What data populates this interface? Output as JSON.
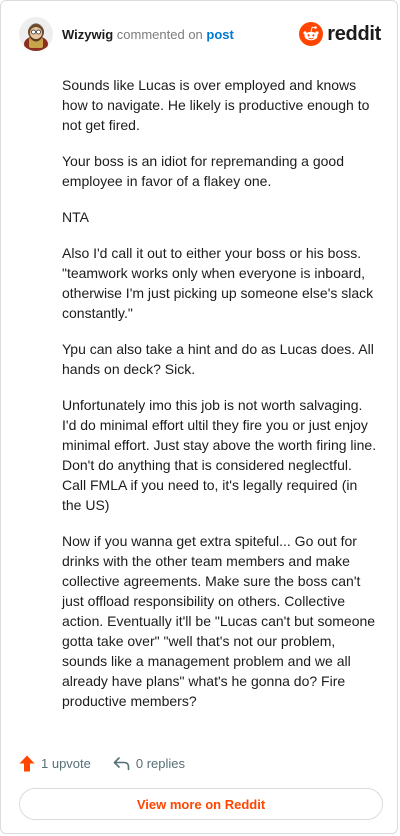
{
  "comment": {
    "author": "Wizywig",
    "action_text": "commented on",
    "link_text": "post",
    "brand_name": "reddit",
    "paragraphs": [
      "Sounds like Lucas is over employed and knows how to navigate. He likely is productive enough to not get fired.",
      "Your boss is an idiot for repremanding a good employee in favor of a flakey one.",
      "NTA",
      "Also I'd call it out to either your boss or his boss. \"teamwork works only when everyone is inboard, otherwise I'm just picking up someone else's slack constantly.\"",
      "Ypu can also take a hint and do as Lucas does. All hands on deck? Sick.",
      "Unfortunately imo this job is not worth salvaging. I'd do minimal effort ultil they fire you or just enjoy minimal effort. Just stay above the worth firing line. Don't do anything that is considered neglectful. Call FMLA if you need to, it's legally required (in the US)",
      "Now if you wanna get extra spiteful... Go out for drinks with the other team members and make collective agreements. Make sure the boss can't just offload responsibility on others. Collective action. Eventually it'll be \"Lucas can't but someone gotta take over\" \"well that's not our problem, sounds like a management problem and we all already have plans\" what's he gonna do? Fire productive members?"
    ]
  },
  "footer": {
    "upvote_label": "1 upvote",
    "replies_label": "0 replies",
    "view_more_label": "View more on Reddit"
  },
  "colors": {
    "accent": "#ff4500",
    "link": "#0079d3",
    "muted": "#7c7c7c"
  },
  "icons": {
    "avatar": "avatar-image",
    "brand": "reddit-logo-icon",
    "upvote": "upvote-arrow-icon",
    "reply": "reply-arrow-icon"
  }
}
